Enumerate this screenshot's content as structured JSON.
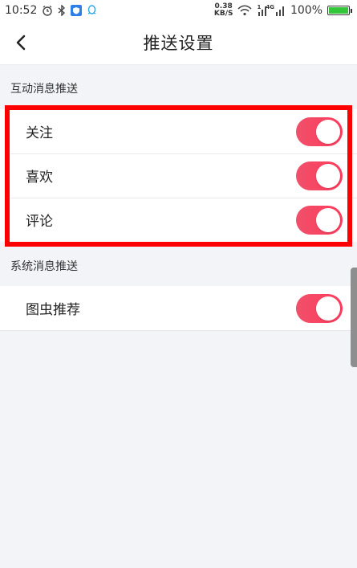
{
  "status_bar": {
    "time": "10:52",
    "net_speed_value": "0.38",
    "net_speed_unit": "KB/S",
    "signal_label_1": "1",
    "signal_label_2": "4G",
    "battery": "100%"
  },
  "nav": {
    "title": "推送设置"
  },
  "sections": [
    {
      "title": "互动消息推送",
      "items": [
        {
          "label": "关注",
          "enabled": true
        },
        {
          "label": "喜欢",
          "enabled": true
        },
        {
          "label": "评论",
          "enabled": true
        }
      ]
    },
    {
      "title": "系统消息推送",
      "items": [
        {
          "label": "图虫推荐",
          "enabled": true
        }
      ]
    }
  ],
  "colors": {
    "toggle_on": "#ff3b5c",
    "highlight": "#ff0000",
    "background": "#f3f4f8"
  }
}
